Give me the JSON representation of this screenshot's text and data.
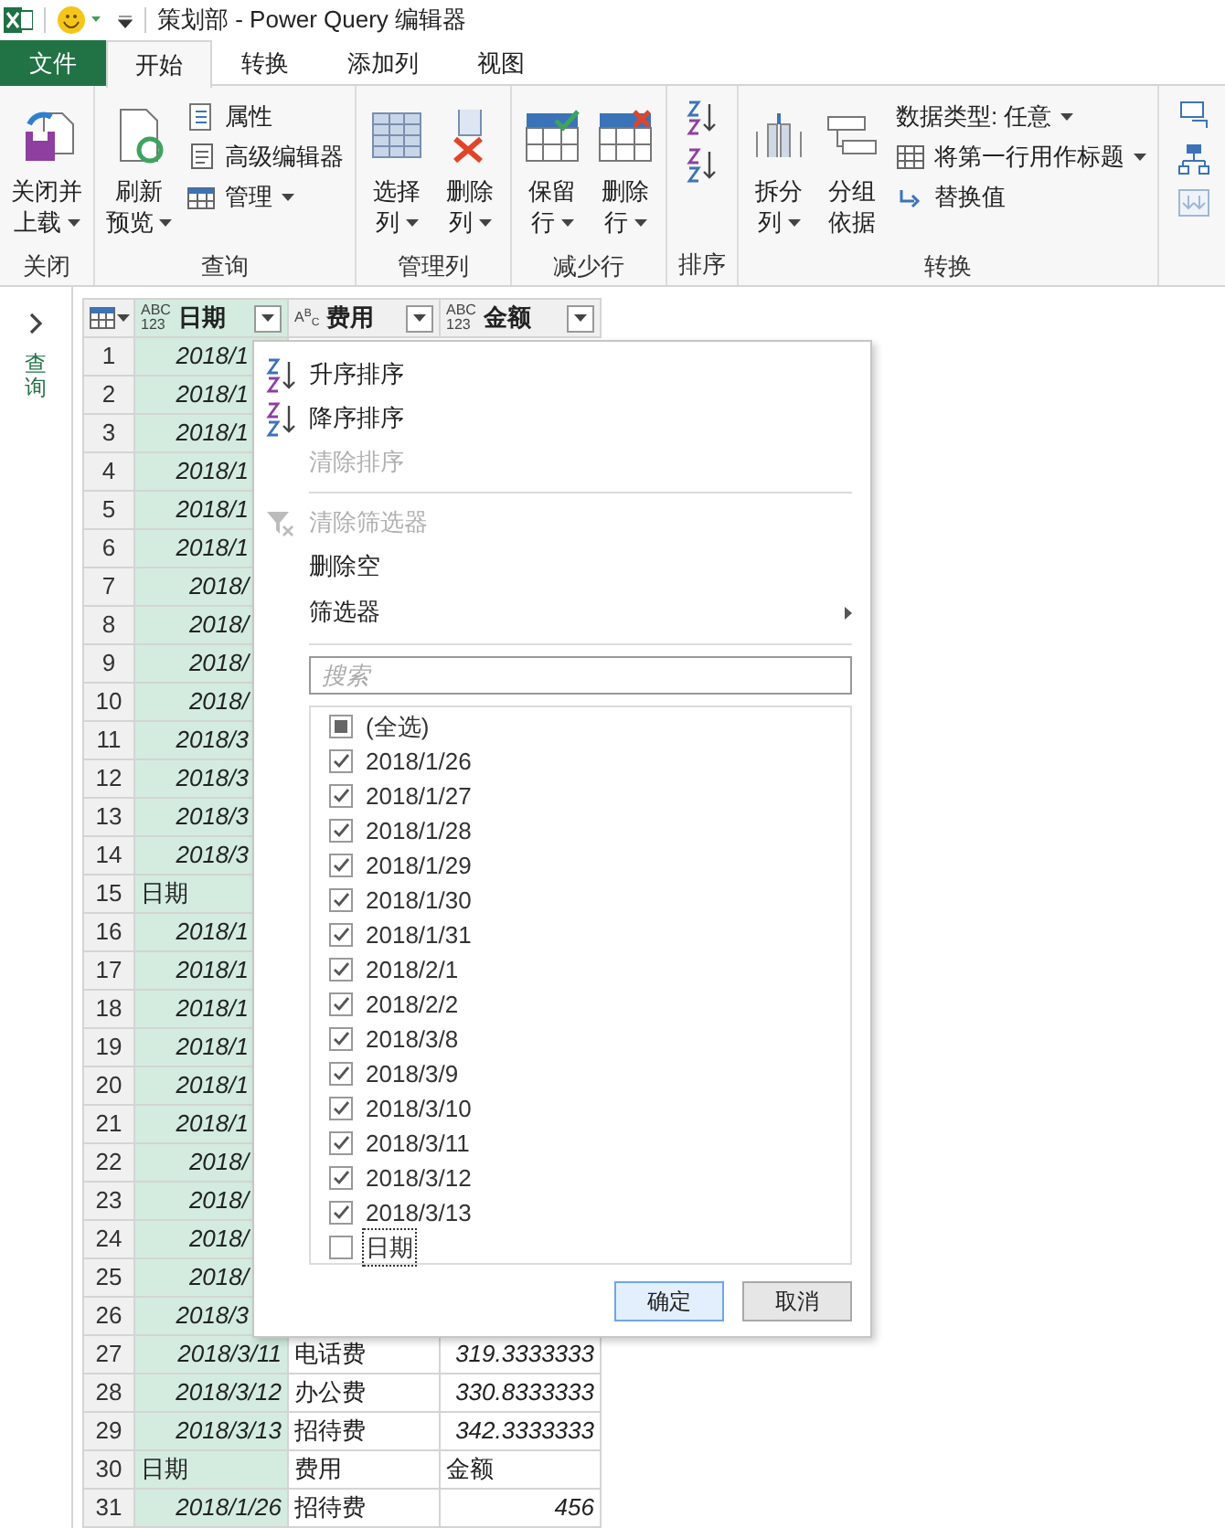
{
  "window": {
    "title": "策划部 - Power Query 编辑器"
  },
  "ribbon_tabs": [
    {
      "label": "文件",
      "kind": "file",
      "selected": false
    },
    {
      "label": "开始",
      "kind": "tab",
      "selected": true
    },
    {
      "label": "转换",
      "kind": "tab",
      "selected": false
    },
    {
      "label": "添加列",
      "kind": "tab",
      "selected": false
    },
    {
      "label": "视图",
      "kind": "tab",
      "selected": false
    }
  ],
  "ribbon_groups": [
    {
      "label": "关闭",
      "items": [
        {
          "kind": "large",
          "lines": [
            "关闭并",
            "上载"
          ],
          "dropdown": true
        }
      ]
    },
    {
      "label": "查询",
      "items": [
        {
          "kind": "large",
          "lines": [
            "刷新",
            "预览"
          ],
          "dropdown": true
        },
        {
          "kind": "stack",
          "items": [
            {
              "label": "属性",
              "dropdown": false
            },
            {
              "label": "高级编辑器",
              "dropdown": false
            },
            {
              "label": "管理",
              "dropdown": true
            }
          ]
        }
      ]
    },
    {
      "label": "管理列",
      "items": [
        {
          "kind": "large",
          "lines": [
            "选择",
            "列"
          ],
          "dropdown": true
        },
        {
          "kind": "large",
          "lines": [
            "删除",
            "列"
          ],
          "dropdown": true
        }
      ]
    },
    {
      "label": "减少行",
      "items": [
        {
          "kind": "large",
          "lines": [
            "保留",
            "行"
          ],
          "dropdown": true
        },
        {
          "kind": "large",
          "lines": [
            "删除",
            "行"
          ],
          "dropdown": true
        }
      ]
    },
    {
      "label": "排序",
      "items": [
        {
          "kind": "icons"
        }
      ]
    },
    {
      "label": "转换",
      "items": [
        {
          "kind": "large",
          "lines": [
            "拆分",
            "列"
          ],
          "dropdown": true
        },
        {
          "kind": "large",
          "lines": [
            "分组",
            "依据"
          ],
          "dropdown": false
        },
        {
          "kind": "stack",
          "items": [
            {
              "label": "数据类型: 任意",
              "dropdown": true
            },
            {
              "label": "将第一行用作标题",
              "dropdown": true
            },
            {
              "label": "替换值",
              "dropdown": false
            }
          ]
        }
      ]
    },
    {
      "items": [
        {
          "kind": "icons"
        }
      ]
    }
  ],
  "queries_pane": {
    "label": "查询"
  },
  "table": {
    "columns": [
      {
        "name": "日期",
        "type_badge": [
          "ABC",
          "123"
        ],
        "selected": true
      },
      {
        "name": "费用",
        "type_badge": [
          "A$^{B}$$_{C}$"
        ],
        "selected": false
      },
      {
        "name": "金额",
        "type_badge": [
          "ABC",
          "123"
        ],
        "selected": false
      }
    ],
    "rows": [
      {
        "number": "1",
        "cells": [
          {
            "text": "2018/1",
            "kind": "date"
          }
        ]
      },
      {
        "number": "2",
        "cells": [
          {
            "text": "2018/1",
            "kind": "date"
          }
        ]
      },
      {
        "number": "3",
        "cells": [
          {
            "text": "2018/1",
            "kind": "date"
          }
        ]
      },
      {
        "number": "4",
        "cells": [
          {
            "text": "2018/1",
            "kind": "date"
          }
        ]
      },
      {
        "number": "5",
        "cells": [
          {
            "text": "2018/1",
            "kind": "date"
          }
        ]
      },
      {
        "number": "6",
        "cells": [
          {
            "text": "2018/1",
            "kind": "date"
          }
        ]
      },
      {
        "number": "7",
        "cells": [
          {
            "text": "2018/",
            "kind": "date"
          }
        ]
      },
      {
        "number": "8",
        "cells": [
          {
            "text": "2018/",
            "kind": "date"
          }
        ]
      },
      {
        "number": "9",
        "cells": [
          {
            "text": "2018/",
            "kind": "date"
          }
        ]
      },
      {
        "number": "10",
        "cells": [
          {
            "text": "2018/",
            "kind": "date"
          }
        ]
      },
      {
        "number": "11",
        "cells": [
          {
            "text": "2018/3",
            "kind": "date"
          }
        ]
      },
      {
        "number": "12",
        "cells": [
          {
            "text": "2018/3",
            "kind": "date"
          }
        ]
      },
      {
        "number": "13",
        "cells": [
          {
            "text": "2018/3",
            "kind": "date"
          }
        ]
      },
      {
        "number": "14",
        "cells": [
          {
            "text": "2018/3",
            "kind": "date"
          }
        ]
      },
      {
        "number": "15",
        "cells": [
          {
            "text": "日期",
            "kind": "text"
          }
        ]
      },
      {
        "number": "16",
        "cells": [
          {
            "text": "2018/1",
            "kind": "date"
          }
        ]
      },
      {
        "number": "17",
        "cells": [
          {
            "text": "2018/1",
            "kind": "date"
          }
        ]
      },
      {
        "number": "18",
        "cells": [
          {
            "text": "2018/1",
            "kind": "date"
          }
        ]
      },
      {
        "number": "19",
        "cells": [
          {
            "text": "2018/1",
            "kind": "date"
          }
        ]
      },
      {
        "number": "20",
        "cells": [
          {
            "text": "2018/1",
            "kind": "date"
          }
        ]
      },
      {
        "number": "21",
        "cells": [
          {
            "text": "2018/1",
            "kind": "date"
          }
        ]
      },
      {
        "number": "22",
        "cells": [
          {
            "text": "2018/",
            "kind": "date"
          }
        ]
      },
      {
        "number": "23",
        "cells": [
          {
            "text": "2018/",
            "kind": "date"
          }
        ]
      },
      {
        "number": "24",
        "cells": [
          {
            "text": "2018/",
            "kind": "date"
          }
        ]
      },
      {
        "number": "25",
        "cells": [
          {
            "text": "2018/",
            "kind": "date"
          }
        ]
      },
      {
        "number": "26",
        "cells": [
          {
            "text": "2018/3",
            "kind": "date"
          }
        ]
      },
      {
        "number": "27",
        "cells": [
          {
            "text": "2018/3/11",
            "kind": "date"
          },
          {
            "text": "电话费",
            "kind": "text"
          },
          {
            "text": "319.3333333",
            "kind": "number"
          }
        ]
      },
      {
        "number": "28",
        "cells": [
          {
            "text": "2018/3/12",
            "kind": "date"
          },
          {
            "text": "办公费",
            "kind": "text"
          },
          {
            "text": "330.8333333",
            "kind": "number"
          }
        ]
      },
      {
        "number": "29",
        "cells": [
          {
            "text": "2018/3/13",
            "kind": "date"
          },
          {
            "text": "招待费",
            "kind": "text"
          },
          {
            "text": "342.3333333",
            "kind": "number"
          }
        ]
      },
      {
        "number": "30",
        "cells": [
          {
            "text": "日期",
            "kind": "text"
          },
          {
            "text": "费用",
            "kind": "text"
          },
          {
            "text": "金额",
            "kind": "text"
          }
        ]
      },
      {
        "number": "31",
        "cells": [
          {
            "text": "2018/1/26",
            "kind": "date"
          },
          {
            "text": "招待费",
            "kind": "text"
          },
          {
            "text": "456",
            "kind": "number"
          }
        ]
      }
    ]
  },
  "filter_menu": {
    "sections": [
      {
        "items": [
          {
            "label": "升序排序",
            "disabled": false,
            "submenu": false
          },
          {
            "label": "降序排序",
            "disabled": false,
            "submenu": false
          },
          {
            "label": "清除排序",
            "disabled": true,
            "submenu": false
          }
        ]
      },
      {
        "items": [
          {
            "label": "清除筛选器",
            "disabled": true,
            "submenu": false
          },
          {
            "label": "删除空",
            "disabled": false,
            "submenu": false
          },
          {
            "label": "筛选器",
            "disabled": false,
            "submenu": true
          }
        ]
      }
    ],
    "search": {
      "placeholder": "搜索"
    },
    "values": [
      {
        "label": "(全选)",
        "kind": "select_all",
        "checked": false,
        "focused": false
      },
      {
        "label": "2018/1/26",
        "kind": "value",
        "checked": true,
        "focused": false
      },
      {
        "label": "2018/1/27",
        "kind": "value",
        "checked": true,
        "focused": false
      },
      {
        "label": "2018/1/28",
        "kind": "value",
        "checked": true,
        "focused": false
      },
      {
        "label": "2018/1/29",
        "kind": "value",
        "checked": true,
        "focused": false
      },
      {
        "label": "2018/1/30",
        "kind": "value",
        "checked": true,
        "focused": false
      },
      {
        "label": "2018/1/31",
        "kind": "value",
        "checked": true,
        "focused": false
      },
      {
        "label": "2018/2/1",
        "kind": "value",
        "checked": true,
        "focused": false
      },
      {
        "label": "2018/2/2",
        "kind": "value",
        "checked": true,
        "focused": false
      },
      {
        "label": "2018/3/8",
        "kind": "value",
        "checked": true,
        "focused": false
      },
      {
        "label": "2018/3/9",
        "kind": "value",
        "checked": true,
        "focused": false
      },
      {
        "label": "2018/3/10",
        "kind": "value",
        "checked": true,
        "focused": false
      },
      {
        "label": "2018/3/11",
        "kind": "value",
        "checked": true,
        "focused": false
      },
      {
        "label": "2018/3/12",
        "kind": "value",
        "checked": true,
        "focused": false
      },
      {
        "label": "2018/3/13",
        "kind": "value",
        "checked": true,
        "focused": false
      },
      {
        "label": "日期",
        "kind": "value",
        "checked": false,
        "focused": true
      }
    ],
    "buttons": [
      {
        "label": "确定",
        "primary": true
      },
      {
        "label": "取消",
        "primary": false
      }
    ]
  }
}
